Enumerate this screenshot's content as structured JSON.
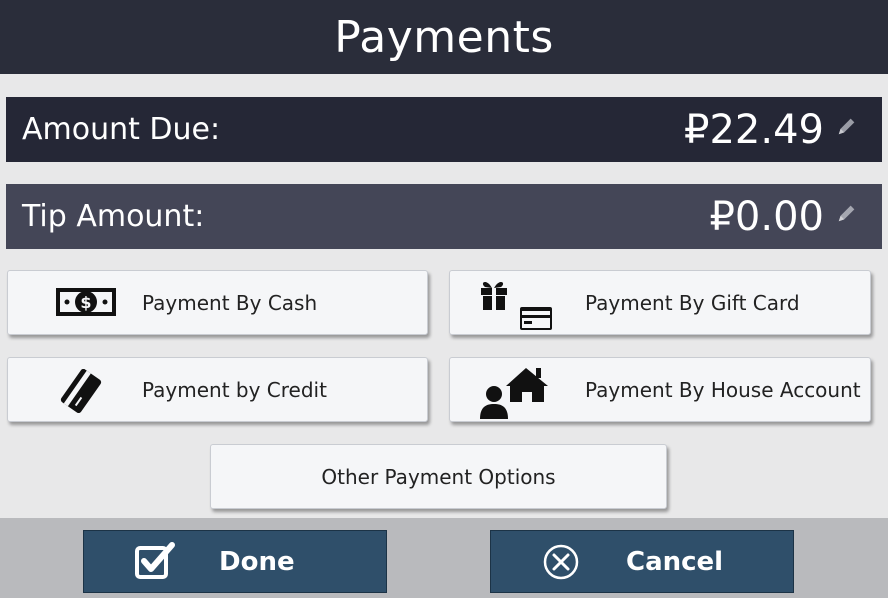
{
  "header": {
    "title": "Payments"
  },
  "amount_due": {
    "label": "Amount Due:",
    "value": "₽22.49",
    "icon": "pencil-icon"
  },
  "tip_amount": {
    "label": "Tip Amount:",
    "value": "₽0.00",
    "icon": "pencil-icon"
  },
  "payment_options": {
    "cash": {
      "label": "Payment By Cash",
      "icon": "cash-icon"
    },
    "gift_card": {
      "label": "Payment By Gift Card",
      "icon": "gift-card-icon"
    },
    "credit": {
      "label": "Payment by Credit",
      "icon": "credit-card-icon"
    },
    "house_account": {
      "label": "Payment By House Account",
      "icon": "house-account-icon"
    },
    "other": {
      "label": "Other Payment Options"
    }
  },
  "footer": {
    "done_label": "Done",
    "cancel_label": "Cancel"
  },
  "colors": {
    "header_bg": "#2a2d3a",
    "amount_due_bg": "#252736",
    "tip_amount_bg": "#444657",
    "footer_button_bg": "#2f4f6a",
    "page_bg": "#e8e8e9"
  }
}
